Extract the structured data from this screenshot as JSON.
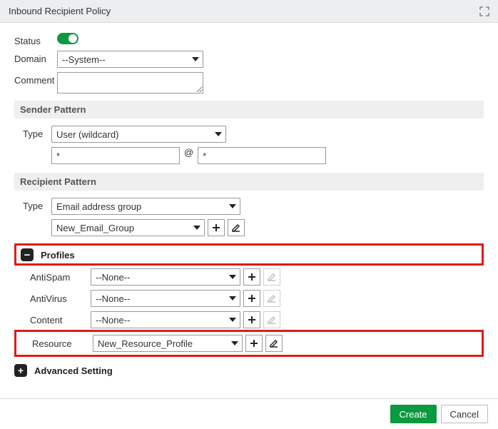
{
  "header": {
    "title": "Inbound Recipient Policy"
  },
  "form": {
    "status_label": "Status",
    "domain_label": "Domain",
    "domain_value": "--System--",
    "comment_label": "Comment"
  },
  "sender": {
    "section": "Sender Pattern",
    "type_label": "Type",
    "type_value": "User (wildcard)",
    "local": "*",
    "at": "@",
    "domain": "*"
  },
  "recipient": {
    "section": "Recipient Pattern",
    "type_label": "Type",
    "type_value": "Email address group",
    "group_value": "New_Email_Group"
  },
  "profiles": {
    "section": "Profiles",
    "antispam_label": "AntiSpam",
    "antispam_value": "--None--",
    "antivirus_label": "AntiVirus",
    "antivirus_value": "--None--",
    "content_label": "Content",
    "content_value": "--None--",
    "resource_label": "Resource",
    "resource_value": "New_Resource_Profile"
  },
  "advanced": {
    "section": "Advanced Setting"
  },
  "footer": {
    "create": "Create",
    "cancel": "Cancel"
  }
}
